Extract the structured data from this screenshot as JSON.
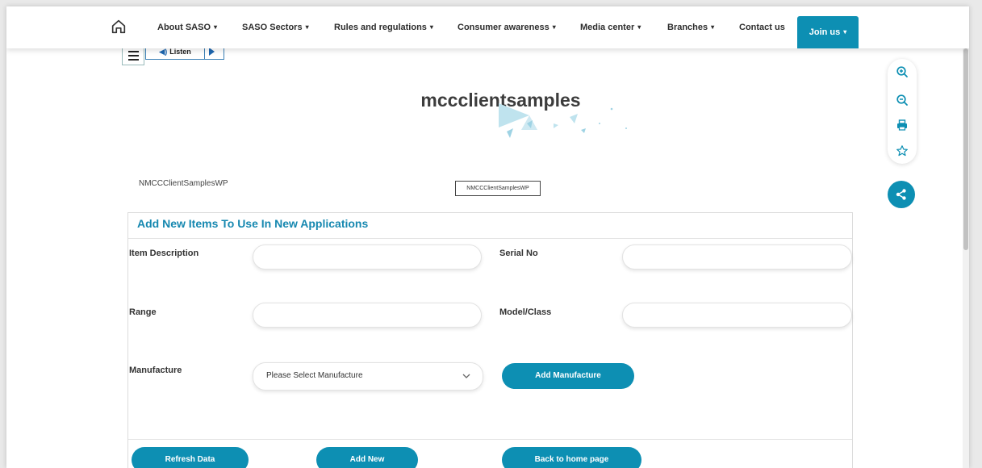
{
  "nav": {
    "items": [
      {
        "label": "About SASO",
        "dropdown": true
      },
      {
        "label": "SASO Sectors",
        "dropdown": true
      },
      {
        "label": "Rules and regulations",
        "dropdown": true
      },
      {
        "label": "Consumer awareness",
        "dropdown": true
      },
      {
        "label": "Media center",
        "dropdown": true
      },
      {
        "label": "Branches",
        "dropdown": true
      },
      {
        "label": "Contact us",
        "dropdown": false
      }
    ],
    "join_label": "Join us",
    "caret": "▾"
  },
  "listen": {
    "label": "Listen"
  },
  "page_title": "mccclientsamples",
  "webpart": {
    "label": "NMCCClientSamplesWP",
    "box_text": "NMCCClientSamplesWP"
  },
  "form": {
    "title": "Add New Items To Use In New Applications",
    "item_description_label": "Item Description",
    "serial_no_label": "Serial No",
    "range_label": "Range",
    "model_class_label": "Model/Class",
    "manufacture_label": "Manufacture",
    "manufacture_selected": "Please Select Manufacture",
    "add_manufacture_label": "Add Manufacture",
    "refresh_label": "Refresh Data",
    "add_new_label": "Add New",
    "back_home_label": "Back to home page"
  },
  "colors": {
    "accent": "#0d8fb3",
    "title_blue": "#1688b0"
  }
}
